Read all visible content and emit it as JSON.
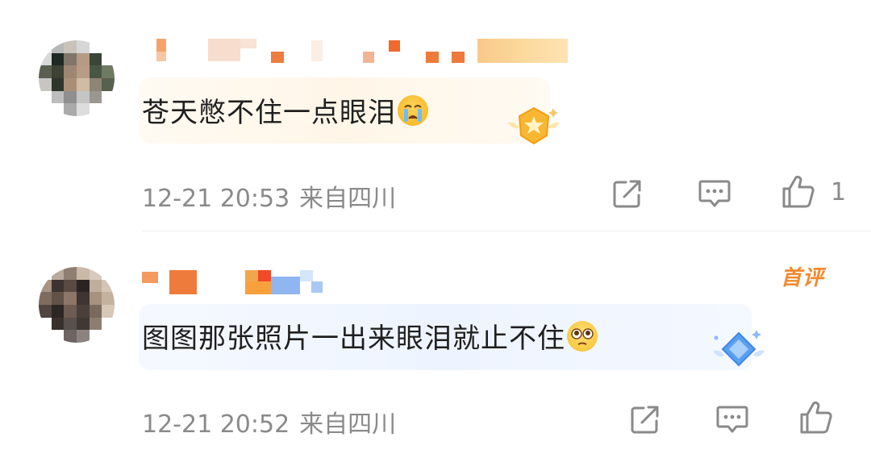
{
  "comments": [
    {
      "text": "苍天憋不住一点眼泪",
      "emoji": "crying-face",
      "time": "12-21 20:53",
      "location": "来自四川",
      "like_count": "1",
      "badge": "gold-star-badge"
    },
    {
      "text": "图图那张照片一出来眼泪就止不住",
      "emoji": "pleading-face",
      "time": "12-21 20:52",
      "location": "来自四川",
      "like_count": "",
      "tag": "首评",
      "badge": "blue-diamond-badge"
    }
  ],
  "colors": {
    "text": "#1f1f1f",
    "meta": "#8a8a8a",
    "first_tag": "#f28a2e",
    "gold_badge": "#f7b733",
    "blue_badge": "#5aa0f0"
  }
}
